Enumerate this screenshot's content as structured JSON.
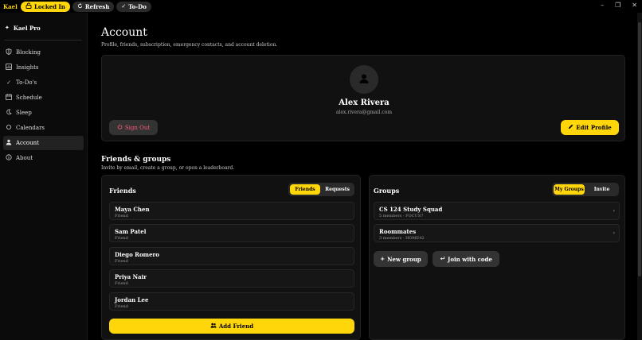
{
  "titlebar": {
    "app_name": "Kael",
    "locked_label": "Locked In",
    "refresh_label": "Refresh",
    "todo_label": "To-Do",
    "controls": [
      "–",
      "❐",
      "✕"
    ]
  },
  "sidebar": {
    "brand": "Kael Pro",
    "items": [
      {
        "label": "Blocking",
        "icon": "shield-icon"
      },
      {
        "label": "Insights",
        "icon": "chart-icon"
      },
      {
        "label": "To-Do's",
        "icon": "check-icon"
      },
      {
        "label": "Schedule",
        "icon": "calendar-icon"
      },
      {
        "label": "Sleep",
        "icon": "moon-icon"
      },
      {
        "label": "Calendars",
        "icon": "circle-icon"
      },
      {
        "label": "Account",
        "icon": "person-icon",
        "active": true
      },
      {
        "label": "About",
        "icon": "info-icon"
      }
    ]
  },
  "header": {
    "title": "Account",
    "subtitle": "Profile, friends, subscription, emergency contacts, and account deletion."
  },
  "profile": {
    "name": "Alex Rivera",
    "email": "alex.rivera@gmail.com",
    "sign_out_label": "Sign Out",
    "edit_label": "Edit Profile"
  },
  "social": {
    "title": "Friends & groups",
    "subtitle": "Invite by email, create a group, or open a leaderboard."
  },
  "friends": {
    "title": "Friends",
    "tab_friends": "Friends",
    "tab_requests": "Requests",
    "list": [
      {
        "name": "Maya Chen",
        "status": "Friend"
      },
      {
        "name": "Sam Patel",
        "status": "Friend"
      },
      {
        "name": "Diego Romero",
        "status": "Friend"
      },
      {
        "name": "Priya Nair",
        "status": "Friend"
      },
      {
        "name": "Jordan Lee",
        "status": "Friend"
      }
    ],
    "add_label": "Add Friend"
  },
  "groups": {
    "title": "Groups",
    "tab_my_groups": "My Groups",
    "tab_invite": "Invite",
    "list": [
      {
        "name": "CS 124 Study Squad",
        "meta": "5 members · FOCUS7"
      },
      {
        "name": "Roommates",
        "meta": "3 members · HOME42"
      }
    ],
    "new_group_label": "New group",
    "join_label": "Join with code"
  },
  "colors": {
    "accent": "#FFD60A",
    "danger": "#FF5A7A",
    "background": "#000000"
  }
}
